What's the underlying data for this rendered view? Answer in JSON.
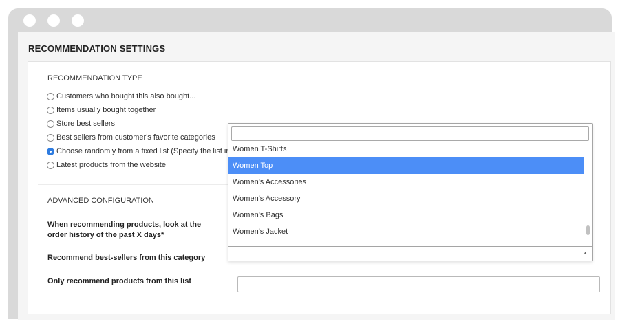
{
  "window": {
    "controls": [
      "window-dot",
      "window-dot",
      "window-dot"
    ]
  },
  "section": {
    "title": "RECOMMENDATION SETTINGS"
  },
  "recommendation_type": {
    "heading": "RECOMMENDATION TYPE",
    "options": [
      {
        "label": "Customers who bought this also bought...",
        "checked": false
      },
      {
        "label": "Items usually bought together",
        "checked": false
      },
      {
        "label": "Store best sellers",
        "checked": false
      },
      {
        "label": "Best sellers from customer's favorite categories",
        "checked": false
      },
      {
        "label": "Choose randomly from a fixed list (Specify the list in Ac",
        "checked": true
      },
      {
        "label": "Latest products from the website",
        "checked": false
      }
    ]
  },
  "advanced": {
    "heading": "ADVANCED CONFIGURATION",
    "order_history_label": "When recommending products, look at the order history of the past X days*",
    "best_sellers_category_label": "Recommend best-sellers from this category",
    "only_list_label": "Only recommend products from this list",
    "only_list_value": ""
  },
  "category_dropdown": {
    "search_value": "",
    "items": [
      {
        "label": "Women T-Shirts",
        "highlighted": false
      },
      {
        "label": "Women Top",
        "highlighted": true
      },
      {
        "label": "Women's Accessories",
        "highlighted": false
      },
      {
        "label": "Women's Accessory",
        "highlighted": false
      },
      {
        "label": "Women's Bags",
        "highlighted": false
      },
      {
        "label": "Women's Jacket",
        "highlighted": false
      }
    ],
    "selected_value": "",
    "arrow_icon": "caret-up-icon"
  },
  "colors": {
    "highlight": "#4c8ef7",
    "radio_checked": "#2f7ce0",
    "window_frame": "#d9d9d9"
  }
}
